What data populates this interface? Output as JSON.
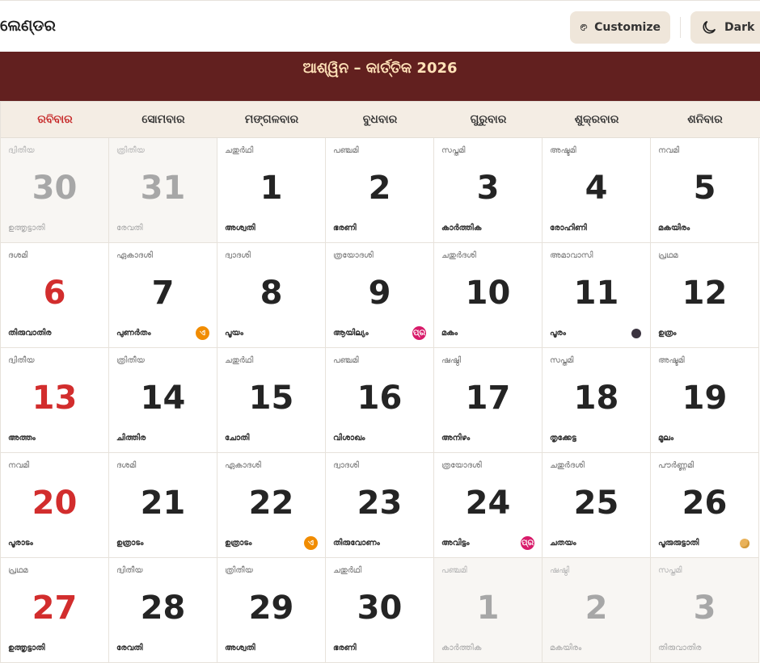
{
  "header": {
    "title": "ଲେଣ୍ଡର",
    "customize_label": "Customize",
    "dark_label": "Dark"
  },
  "banner": {
    "title": "ଆଶ୍ୱିନ – କାର୍ତ୍ତିକ 2026"
  },
  "weekdays": [
    "ରବିବାର",
    "ସୋମବାର",
    "ମଙ୍ଗଳବାର",
    "ବୁଧବାର",
    "ଗୁରୁବାର",
    "ଶୁକ୍ରବାର",
    "ଶନିବାର"
  ],
  "days": [
    {
      "num": "30",
      "tithi": "ദ്വിതീയ",
      "nak": "ഉത്തൃട്ടാതി",
      "other": true
    },
    {
      "num": "31",
      "tithi": "ത്രിതീയ",
      "nak": "രേവതി",
      "other": true
    },
    {
      "num": "1",
      "tithi": "ചതുർഥി",
      "nak": "അശ്വതി"
    },
    {
      "num": "2",
      "tithi": "പഞ്ചമി",
      "nak": "ഭരണി"
    },
    {
      "num": "3",
      "tithi": "സപ്തമി",
      "nak": "കാർത്തിക"
    },
    {
      "num": "4",
      "tithi": "അഷ്ടമി",
      "nak": "രോഹിണി"
    },
    {
      "num": "5",
      "tithi": "നവമി",
      "nak": "മകയിരം"
    },
    {
      "num": "6",
      "tithi": "ദശമി",
      "nak": "തിരുവാതിര"
    },
    {
      "num": "7",
      "tithi": "ഏകാദശി",
      "nak": "പുണർതം",
      "badge": "ଏ",
      "badge_color": "orange"
    },
    {
      "num": "8",
      "tithi": "ദ്വാദശി",
      "nak": "പൂയം"
    },
    {
      "num": "9",
      "tithi": "ത്രയോദശി",
      "nak": "ആയില്യം",
      "badge": "ପ୍ର",
      "badge_color": "pink"
    },
    {
      "num": "10",
      "tithi": "ചതുർദശി",
      "nak": "മകം"
    },
    {
      "num": "11",
      "tithi": "അമാവാസി",
      "nak": "പൂരം",
      "moon": "new"
    },
    {
      "num": "12",
      "tithi": "പ്രഥമ",
      "nak": "ഉത്രം"
    },
    {
      "num": "13",
      "tithi": "ദ്വിതീയ",
      "nak": "അത്തം"
    },
    {
      "num": "14",
      "tithi": "ത്രിതീയ",
      "nak": "ചിത്തിര"
    },
    {
      "num": "15",
      "tithi": "ചതുർഥി",
      "nak": "ചോതി"
    },
    {
      "num": "16",
      "tithi": "പഞ്ചമി",
      "nak": "വിശാഖം"
    },
    {
      "num": "17",
      "tithi": "ഷഷ്ഠി",
      "nak": "അനിഴം"
    },
    {
      "num": "18",
      "tithi": "സപ്തമി",
      "nak": "തൃക്കേട്ട"
    },
    {
      "num": "19",
      "tithi": "അഷ്ടമി",
      "nak": "മൂലം"
    },
    {
      "num": "20",
      "tithi": "നവമി",
      "nak": "പൂരാടം"
    },
    {
      "num": "21",
      "tithi": "ദശമി",
      "nak": "ഉത്രാടം"
    },
    {
      "num": "22",
      "tithi": "ഏകാദശി",
      "nak": "ഉത്രാടം",
      "badge": "ଏ",
      "badge_color": "orange"
    },
    {
      "num": "23",
      "tithi": "ദ്വാദശി",
      "nak": "തിരുവോണം"
    },
    {
      "num": "24",
      "tithi": "ത്രയോദശി",
      "nak": "അവിട്ടം",
      "badge": "ପ୍ର",
      "badge_color": "pink"
    },
    {
      "num": "25",
      "tithi": "ചതുർദശി",
      "nak": "ചതയം"
    },
    {
      "num": "26",
      "tithi": "പൗർണ്ണമി",
      "nak": "പൂരുരുട്ടാതി",
      "moon": "full"
    },
    {
      "num": "27",
      "tithi": "പ്രഥമ",
      "nak": "ഉത്തൃട്ടാതി"
    },
    {
      "num": "28",
      "tithi": "ദ്വിതീയ",
      "nak": "രേവതി"
    },
    {
      "num": "29",
      "tithi": "ത്രിതീയ",
      "nak": "അശ്വതി"
    },
    {
      "num": "30",
      "tithi": "ചതുർഥി",
      "nak": "ഭരണി"
    },
    {
      "num": "1",
      "tithi": "പഞ്ചമി",
      "nak": "കാർത്തിക",
      "other": true
    },
    {
      "num": "2",
      "tithi": "ഷഷ്ഠി",
      "nak": "മകയിരം",
      "other": true
    },
    {
      "num": "3",
      "tithi": "സപ്തമി",
      "nak": "തിരുവാതിര",
      "other": true
    }
  ]
}
